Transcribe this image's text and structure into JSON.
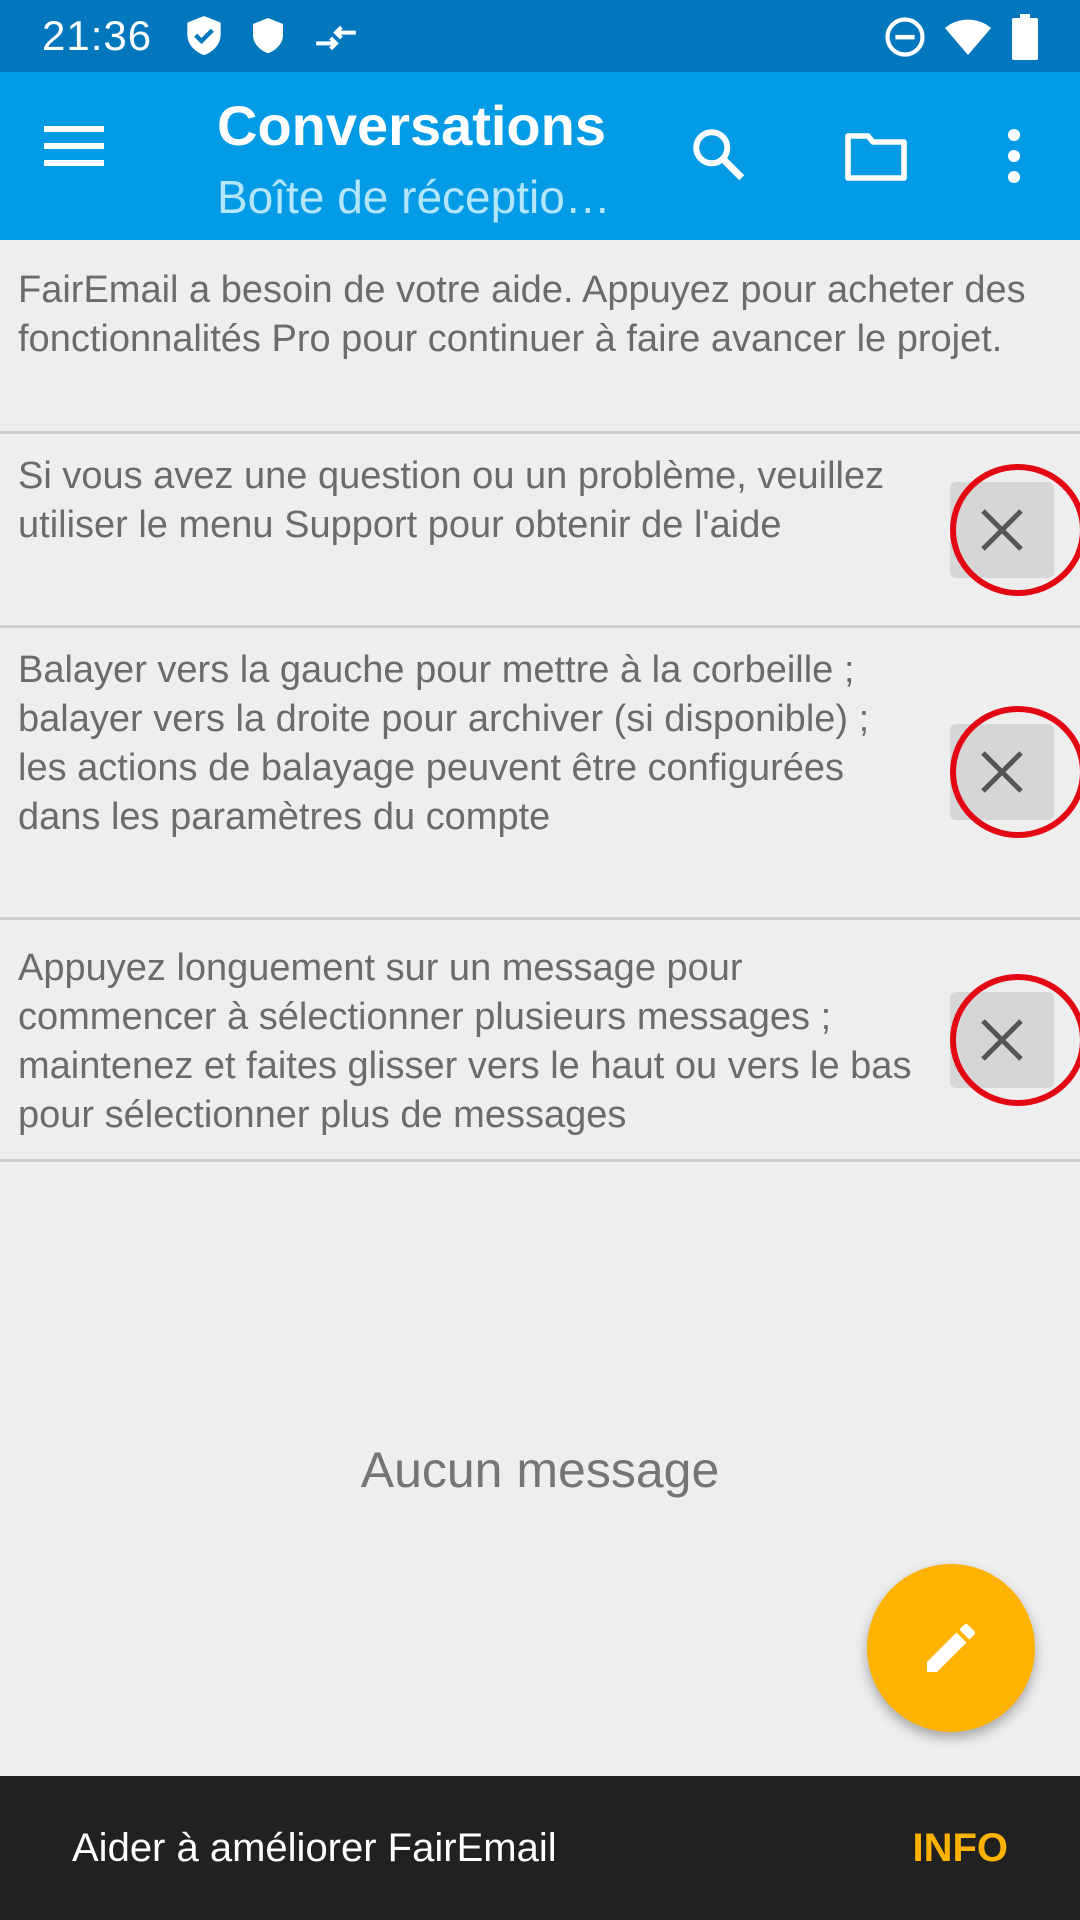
{
  "status_bar": {
    "time": "21:36",
    "icons": [
      "shield-check-icon",
      "shield-icon",
      "transfer-arrows-icon",
      "do-not-disturb-icon",
      "wifi-icon",
      "battery-icon"
    ]
  },
  "app_bar": {
    "title": "Conversations",
    "subtitle": "Boîte de réceptio…",
    "icons": [
      "menu-icon",
      "search-icon",
      "folder-icon",
      "more-vert-icon"
    ],
    "color": "#039be5"
  },
  "hints": [
    {
      "text": "FairEmail a besoin de votre aide. Appuyez pour acheter des fonctionnalités Pro pour continuer à faire avancer le projet."
    },
    {
      "text": "Si vous avez une question ou un problème, veuillez utiliser le menu Support pour obtenir de l'aide"
    },
    {
      "text": "Balayer vers la gauche pour mettre à la corbeille ; balayer vers la droite pour archiver (si disponible) ; les actions de balayage peuvent être configurées dans les paramètres du compte"
    },
    {
      "text": "Appuyez longuement sur un message pour commencer à sélectionner plusieurs messages ; maintenez et faites glisser vers le haut ou vers le bas pour sélectionner plus de messages"
    }
  ],
  "empty_state": "Aucun message",
  "fab": {
    "icon": "pencil-icon",
    "color": "#ffb300"
  },
  "snackbar": {
    "text": "Aider à améliorer FairEmail",
    "action": "INFO",
    "action_color": "#ffb300"
  },
  "highlight_color": "#e30613"
}
